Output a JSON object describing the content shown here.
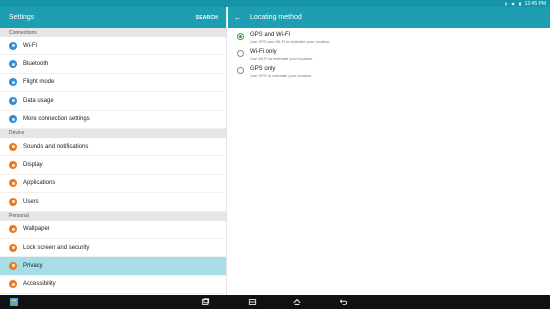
{
  "status_bar": {
    "time": "12:45 PM",
    "icons": [
      "bluetooth-icon",
      "wifi-icon",
      "battery-icon"
    ]
  },
  "settings": {
    "title": "Settings",
    "search_label": "SEARCH",
    "sections": [
      {
        "header": "Connections",
        "items": [
          {
            "label": "Wi-Fi",
            "icon": "wifi-icon",
            "color": "#2f8dd6"
          },
          {
            "label": "Bluetooth",
            "icon": "bluetooth-icon",
            "color": "#2f8dd6"
          },
          {
            "label": "Flight mode",
            "icon": "airplane-icon",
            "color": "#2f8dd6"
          },
          {
            "label": "Data usage",
            "icon": "data-usage-icon",
            "color": "#2f8dd6"
          },
          {
            "label": "More connection settings",
            "icon": "more-connections-icon",
            "color": "#2f8dd6"
          }
        ]
      },
      {
        "header": "Device",
        "items": [
          {
            "label": "Sounds and notifications",
            "icon": "sound-icon",
            "color": "#ec7a1c"
          },
          {
            "label": "Display",
            "icon": "display-icon",
            "color": "#ec7a1c"
          },
          {
            "label": "Applications",
            "icon": "applications-icon",
            "color": "#ec7a1c"
          },
          {
            "label": "Users",
            "icon": "users-icon",
            "color": "#ec7a1c"
          }
        ]
      },
      {
        "header": "Personal",
        "items": [
          {
            "label": "Wallpaper",
            "icon": "wallpaper-icon",
            "color": "#ec7a1c"
          },
          {
            "label": "Lock screen and security",
            "icon": "lock-icon",
            "color": "#ec7a1c"
          },
          {
            "label": "Privacy",
            "icon": "privacy-icon",
            "color": "#ec7a1c",
            "selected": true
          },
          {
            "label": "Accessibility",
            "icon": "accessibility-icon",
            "color": "#ec7a1c"
          }
        ]
      }
    ]
  },
  "locating_method": {
    "title": "Locating method",
    "options": [
      {
        "title": "GPS and Wi-Fi",
        "subtitle": "Use GPS and Wi-Fi to estimate your location.",
        "checked": true
      },
      {
        "title": "Wi-Fi only",
        "subtitle": "Use Wi-Fi to estimate your location.",
        "checked": false
      },
      {
        "title": "GPS only",
        "subtitle": "Use GPS to estimate your location.",
        "checked": false
      }
    ]
  },
  "colors": {
    "header_teal": "#1e9eb3",
    "status_teal": "#1795a8",
    "selected_row": "#a6dde6",
    "radio_green": "#3aa33a"
  },
  "nav_bar": {
    "icons": [
      "app-launcher-icon",
      "recent-apps-icon",
      "multi-window-icon",
      "home-icon",
      "back-icon"
    ]
  }
}
